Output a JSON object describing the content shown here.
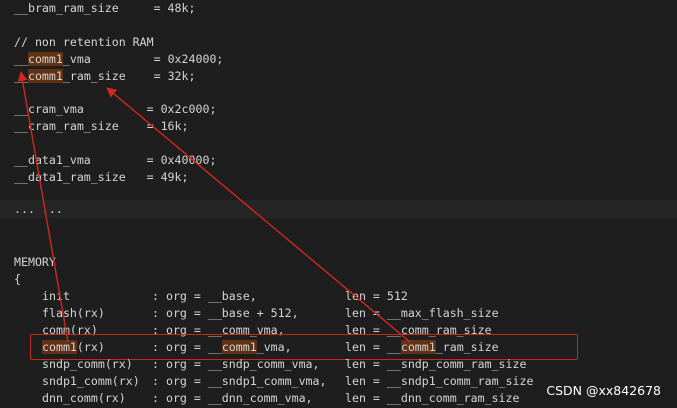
{
  "code": {
    "bram_line": "__bram_ram_size     = 48k;",
    "comment": "// non retention RAM",
    "comm1_vma": {
      "pre": "__",
      "hl": "comm1",
      "post": "_vma         = 0x24000;"
    },
    "comm1_size": {
      "pre": "__",
      "hl": "comm1",
      "post": "_ram_size    = 32k;"
    },
    "cram_vma": "__cram_vma         = 0x2c000;",
    "cram_size": "__cram_ram_size    = 16k;",
    "data1_vma": "__data1_vma        = 0x40000;",
    "data1_size": "__data1_ram_size   = 49k;",
    "ellipsis": "... ...",
    "memory": "MEMORY",
    "brace": "{",
    "rows": [
      {
        "name": "init",
        "org": ": org = __base,",
        "len": "len = 512"
      },
      {
        "name": "flash(rx)",
        "org": ": org = __base + 512,",
        "len": "len = __max_flash_size"
      },
      {
        "name": "comm(rx)",
        "org": ": org = __comm_vma,",
        "len": "len = __comm_ram_size"
      },
      {
        "name": "sndp_comm(rx)",
        "org": ": org = __sndp_comm_vma,",
        "len": "len = __sndp_comm_ram_size"
      },
      {
        "name": "sndp1_comm(rx)",
        "org": ": org = __sndp1_comm_vma,",
        "len": "len = __sndp1_comm_ram_size"
      },
      {
        "name": "dnn_comm(rx)",
        "org": ": org = __dnn_comm_vma,",
        "len": "len = __dnn_comm_ram_size"
      }
    ],
    "comm1_row": {
      "name_hl": "comm1",
      "name_post": "(rx)",
      "org_pre": ": org = __",
      "org_hl": "comm1",
      "org_post": "_vma,",
      "len_pre": "len = __",
      "len_hl": "comm1",
      "len_post": "_ram_size"
    }
  },
  "watermark": "CSDN @xx842678",
  "colors": {
    "highlight": "#613214",
    "arrow": "#d0281c",
    "background": "#1e1e1e"
  }
}
